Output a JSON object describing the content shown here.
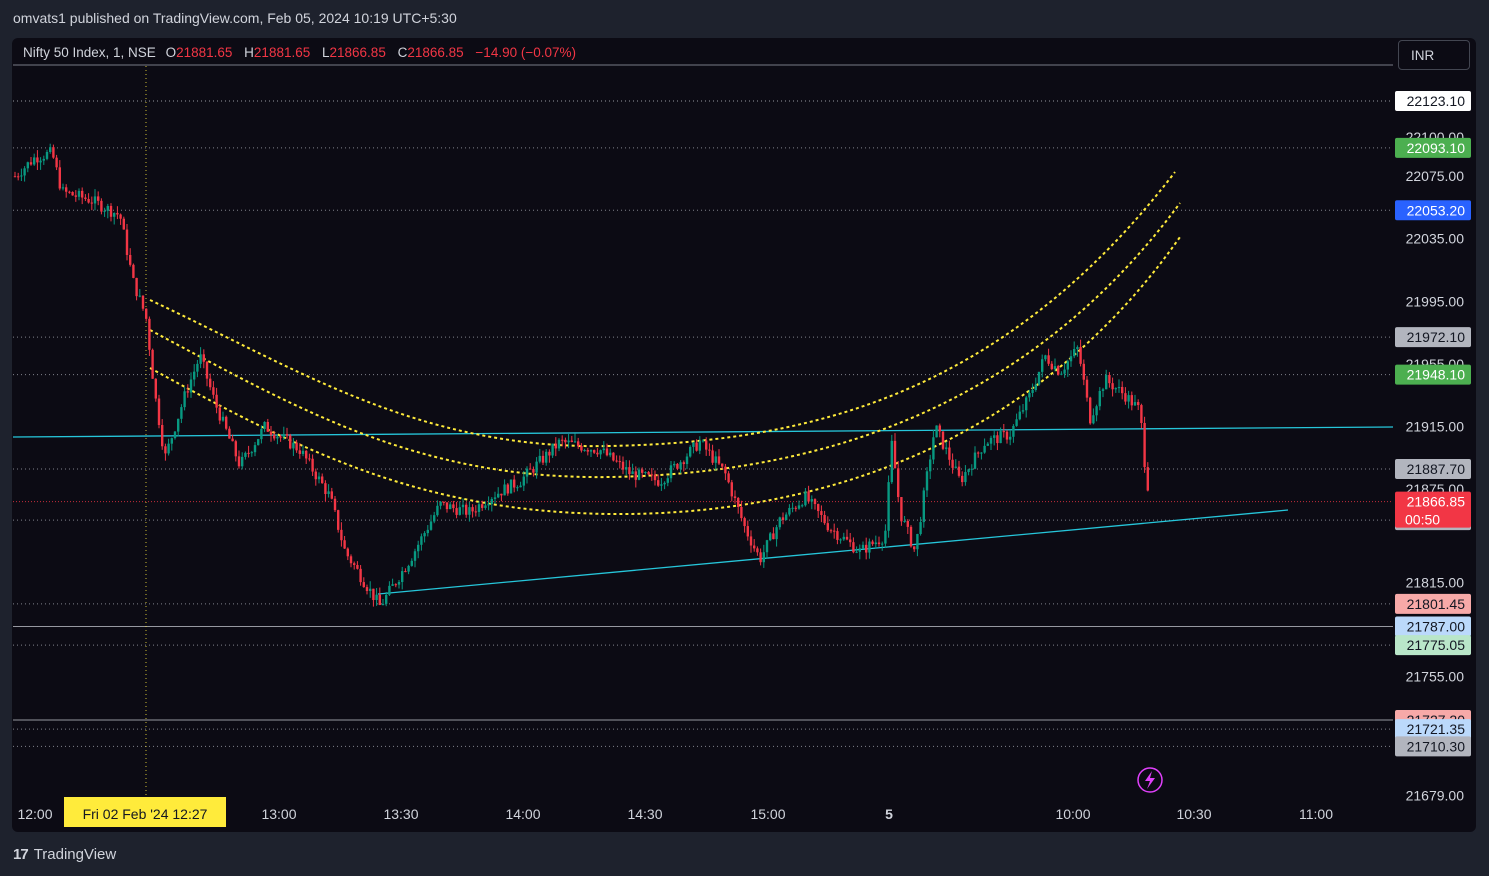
{
  "header": {
    "publisher_line": "omvats1 published on TradingView.com, Feb 05, 2024 10:19 UTC+5:30"
  },
  "legend": {
    "symbol": "Nifty 50 Index, 1, NSE",
    "open_label": "O",
    "open": "21881.65",
    "high_label": "H",
    "high": "21881.65",
    "low_label": "L",
    "low": "21866.85",
    "close_label": "C",
    "close": "21866.85",
    "change": "−14.90 (−0.07%)"
  },
  "currency_button": "INR",
  "footer": {
    "brand": "TradingView",
    "logo_glyph": "17"
  },
  "chart_data": {
    "type": "candlestick",
    "y_range": [
      21660,
      22140
    ],
    "y_ticks": [
      "22100.00",
      "22075.00",
      "22035.00",
      "21995.00",
      "21955.00",
      "21915.00",
      "21875.00",
      "21815.00",
      "21755.00",
      "21679.00"
    ],
    "x_ticks": [
      "12:00",
      "13:00",
      "13:30",
      "14:00",
      "14:30",
      "15:00",
      "5",
      "10:00",
      "10:30",
      "11:00"
    ],
    "crosshair_label": "Fri 02 Feb '24   12:27",
    "price_labels": [
      {
        "value": 22123.1,
        "text": "22123.10",
        "bg": "#ffffff",
        "fg": "#131722",
        "line": "#d1d4dc",
        "style": "dotted"
      },
      {
        "value": 22093.1,
        "text": "22093.10",
        "bg": "#4caf50",
        "fg": "#ffffff",
        "line": "#b2b5be",
        "style": "dotted"
      },
      {
        "value": 22053.2,
        "text": "22053.20",
        "bg": "#2962ff",
        "fg": "#ffffff",
        "line": "#b2b5be",
        "style": "dotted"
      },
      {
        "value": 21972.1,
        "text": "21972.10",
        "bg": "#b2b5be",
        "fg": "#131722",
        "line": "#b2b5be",
        "style": "dotted"
      },
      {
        "value": 21948.1,
        "text": "21948.10",
        "bg": "#4caf50",
        "fg": "#ffffff",
        "line": "#b2b5be",
        "style": "dotted"
      },
      {
        "value": 21887.7,
        "text": "21887.70",
        "bg": "#b2b5be",
        "fg": "#131722",
        "line": "#b2b5be",
        "style": "dotted"
      },
      {
        "value": 21855.05,
        "text": "21855.05",
        "bg": "#b2b5be",
        "fg": "#131722",
        "line": "#b2b5be",
        "style": "dotted"
      },
      {
        "value": 21801.45,
        "text": "21801.45",
        "bg": "#f7a9a8",
        "fg": "#131722",
        "line": "#b2b5be",
        "style": "dotted"
      },
      {
        "value": 21787.0,
        "text": "21787.00",
        "bg": "#bbd9fb",
        "fg": "#131722",
        "line": "#d1d4dc",
        "style": "solid"
      },
      {
        "value": 21775.05,
        "text": "21775.05",
        "bg": "#b9e6c9",
        "fg": "#131722",
        "line": "#b2b5be",
        "style": "dotted"
      },
      {
        "value": 21727.2,
        "text": "21727.20",
        "bg": "#f7a9a8",
        "fg": "#131722",
        "line": "#d1d4dc",
        "style": "solid"
      },
      {
        "value": 21721.35,
        "text": "21721.35",
        "bg": "#bbd9fb",
        "fg": "#131722",
        "line": "#b2b5be",
        "style": "dotted"
      },
      {
        "value": 21710.3,
        "text": "21710.30",
        "bg": "#b2b5be",
        "fg": "#131722",
        "line": "#b2b5be",
        "style": "dotted"
      }
    ],
    "last_price": {
      "value": 21866.85,
      "text": "21866.85",
      "countdown": "00:50",
      "bg": "#f23645",
      "fg": "#ffffff"
    },
    "colors": {
      "up": "#089981",
      "down": "#f23645",
      "trend": "#26c6da",
      "arc": "#ffeb3b",
      "crosshair": "#ffeb3b",
      "grid": "#2a2e39"
    },
    "lightning_icon": "lightning-icon"
  }
}
